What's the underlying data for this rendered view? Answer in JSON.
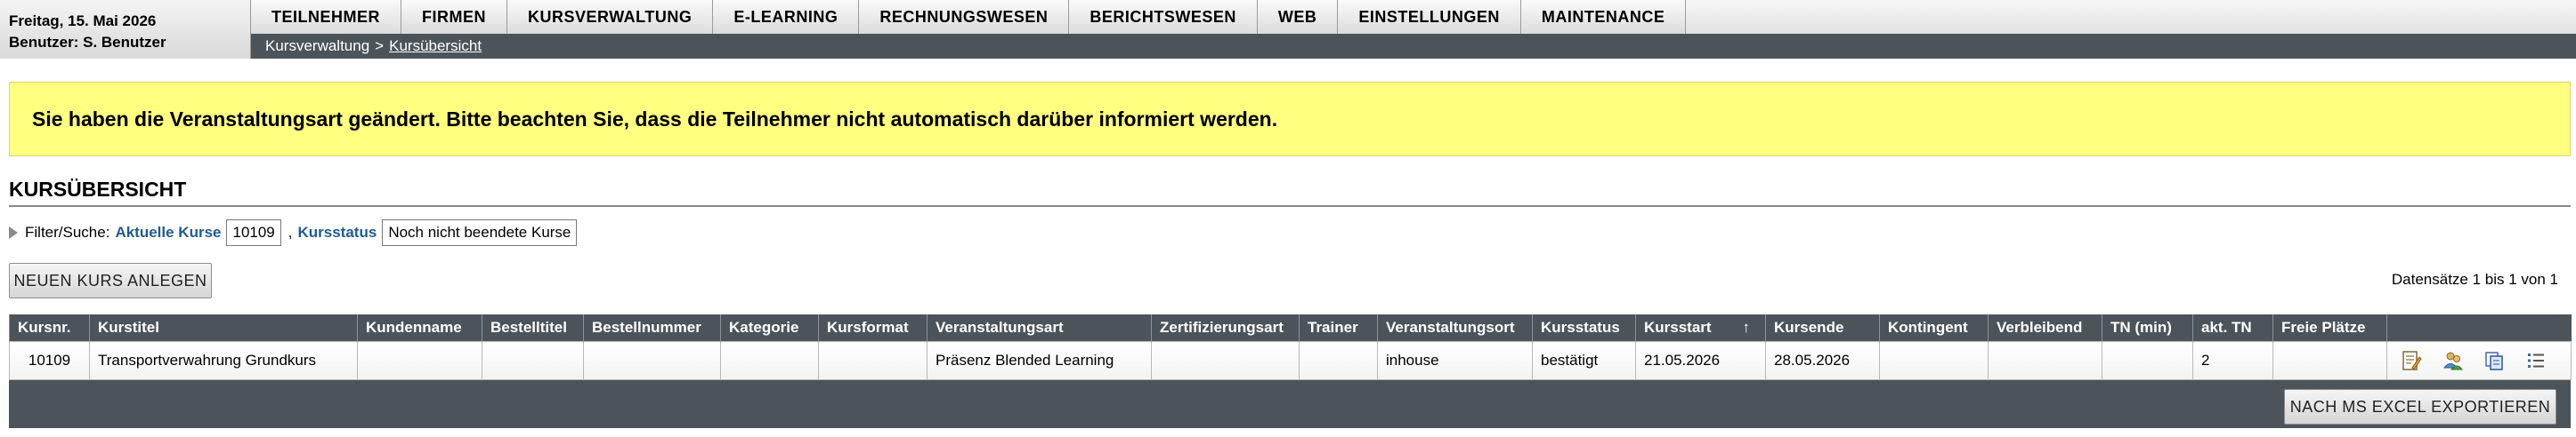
{
  "header": {
    "date": "Freitag, 15. Mai 2026",
    "user": "Benutzer: S. Benutzer",
    "nav": [
      {
        "key": "teilnehmer",
        "label": "TEILNEHMER"
      },
      {
        "key": "firmen",
        "label": "FIRMEN"
      },
      {
        "key": "kursverwaltung",
        "label": "KURSVERWALTUNG"
      },
      {
        "key": "e-learning",
        "label": "E-LEARNING"
      },
      {
        "key": "rechnungswesen",
        "label": "RECHNUNGSWESEN"
      },
      {
        "key": "berichtswesen",
        "label": "BERICHTSWESEN"
      },
      {
        "key": "web",
        "label": "WEB"
      },
      {
        "key": "einstellungen",
        "label": "EINSTELLUNGEN"
      },
      {
        "key": "maintenance",
        "label": "MAINTENANCE"
      }
    ],
    "breadcrumb": {
      "parent": "Kursverwaltung",
      "separator": ">",
      "current": "Kursübersicht"
    }
  },
  "notice": "Sie haben die Veranstaltungsart geändert. Bitte beachten Sie, dass die Teilnehmer nicht automatisch darüber informiert werden.",
  "page_title": "KURSÜBERSICHT",
  "filter": {
    "label": "Filter/Suche:",
    "link1": "Aktuelle Kurse",
    "value1": "10109",
    "comma": ",",
    "link2": "Kursstatus",
    "value2": "Noch nicht beendete Kurse"
  },
  "buttons": {
    "new_course": "NEUEN KURS ANLEGEN",
    "export": "NACH MS EXCEL EXPORTIEREN"
  },
  "records_info": "Datensätze 1 bis 1 von 1",
  "table": {
    "columns": [
      "Kursnr.",
      "Kurstitel",
      "Kundenname",
      "Bestelltitel",
      "Bestellnummer",
      "Kategorie",
      "Kursformat",
      "Veranstaltungsart",
      "Zertifizierungsart",
      "Trainer",
      "Veranstaltungsort",
      "Kursstatus",
      "Kursstart",
      "Kursende",
      "Kontingent",
      "Verbleibend",
      "TN (min)",
      "akt. TN",
      "Freie Plätze",
      ""
    ],
    "sort_indicator": "↑",
    "rows": [
      [
        "10109",
        "Transportverwahrung Grundkurs",
        "",
        "",
        "",
        "",
        "",
        "Präsenz Blended Learning",
        "",
        "",
        "inhouse",
        "bestätigt",
        "21.05.2026",
        "28.05.2026",
        "",
        "",
        "",
        "2",
        "",
        ""
      ]
    ],
    "action_icons": [
      "edit-icon",
      "participants-icon",
      "copy-icon",
      "list-icon"
    ]
  },
  "colors": {
    "header_dark": "#4d5459",
    "notice_bg": "#ffff80",
    "link": "#1f5a96"
  }
}
